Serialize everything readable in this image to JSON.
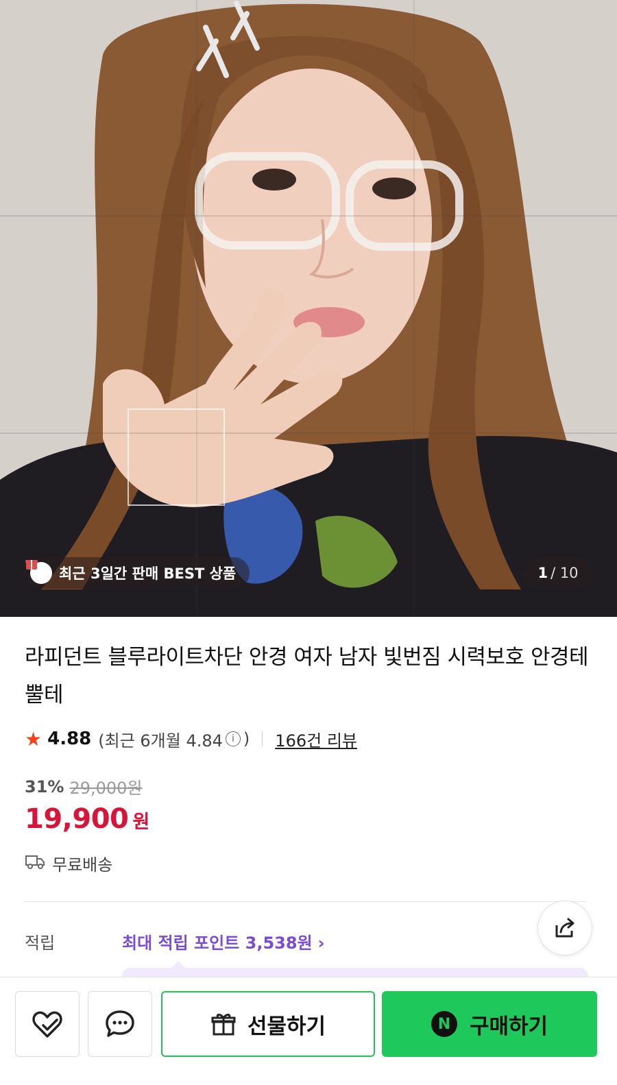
{
  "gallery": {
    "badge_text": "최근 3일간 판매 BEST 상품",
    "current_index": "1",
    "total": "/ 10"
  },
  "product": {
    "title": "라피던트 블루라이트차단 안경 여자 남자 빛번짐 시력보호 안경테 뿔테",
    "rating": "4.88",
    "recent_rating_prefix": "(최근 6개월 4.84",
    "recent_rating_suffix": ")",
    "review_count": "166건 리뷰",
    "discount_rate": "31%",
    "original_price": "29,000원",
    "price": "19,900",
    "currency": "원",
    "shipping": "무료배송"
  },
  "points": {
    "label": "적립",
    "value": "최대 적립 포인트 3,538원",
    "chevron": "›"
  },
  "actions": {
    "gift_label": "선물하기",
    "buy_label": "구매하기",
    "npay_mark": "N"
  },
  "colors": {
    "price_red": "#d8143a",
    "star": "#f4421d",
    "point_purple": "#7a4cd6",
    "buy_green": "#1ec85a"
  },
  "icons": {
    "wishlist": "heart-check-icon",
    "chat": "chat-bubble-icon",
    "share": "share-icon",
    "shipping": "truck-icon",
    "gift": "gift-icon"
  }
}
